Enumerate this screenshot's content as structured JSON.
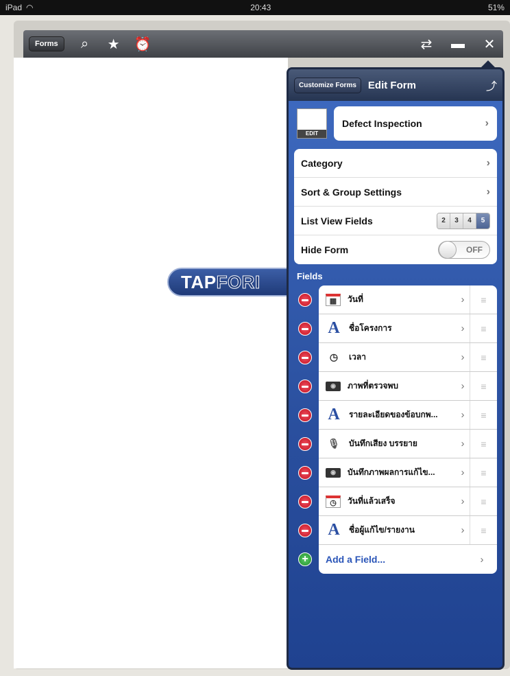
{
  "status_bar": {
    "device": "iPad",
    "time": "20:43",
    "battery": "51%"
  },
  "toolbar": {
    "forms_label": "Forms",
    "icons": [
      "search-icon",
      "star-icon",
      "alarm-icon",
      "sync-icon",
      "folder-icon",
      "tools-icon"
    ]
  },
  "logo": {
    "text_solid": "TAP",
    "text_outline": "FORI"
  },
  "popover": {
    "customize_label": "Customize Forms",
    "title": "Edit Form",
    "thumb_edit_label": "EDIT",
    "form_name": "Defect Inspection",
    "settings": {
      "category": "Category",
      "sort_group": "Sort & Group Settings",
      "list_view_fields": "List View Fields",
      "list_view_options": [
        "2",
        "3",
        "4",
        "5"
      ],
      "list_view_selected": "5",
      "hide_form": "Hide Form",
      "hide_form_state": "OFF"
    },
    "fields_header": "Fields",
    "fields": [
      {
        "icon": "calendar-icon",
        "label": "วันที่"
      },
      {
        "icon": "text-icon",
        "label": "ชื่อโครงการ"
      },
      {
        "icon": "clock-icon",
        "label": "เวลา"
      },
      {
        "icon": "photo-icon",
        "label": "ภาพที่ตรวจพบ"
      },
      {
        "icon": "text-icon",
        "label": "รายละเอียดของข้อบกพ..."
      },
      {
        "icon": "microphone-icon",
        "label": "บันทึกเสียง บรรยาย"
      },
      {
        "icon": "photo-icon",
        "label": "บันทึกภาพผลการแก้ไข..."
      },
      {
        "icon": "calendar-icon",
        "label": "วันที่แล้วเสร็จ"
      },
      {
        "icon": "text-icon",
        "label": "ชื่อผู้แก้ไข/รายงาน"
      }
    ],
    "add_field_label": "Add a Field..."
  }
}
